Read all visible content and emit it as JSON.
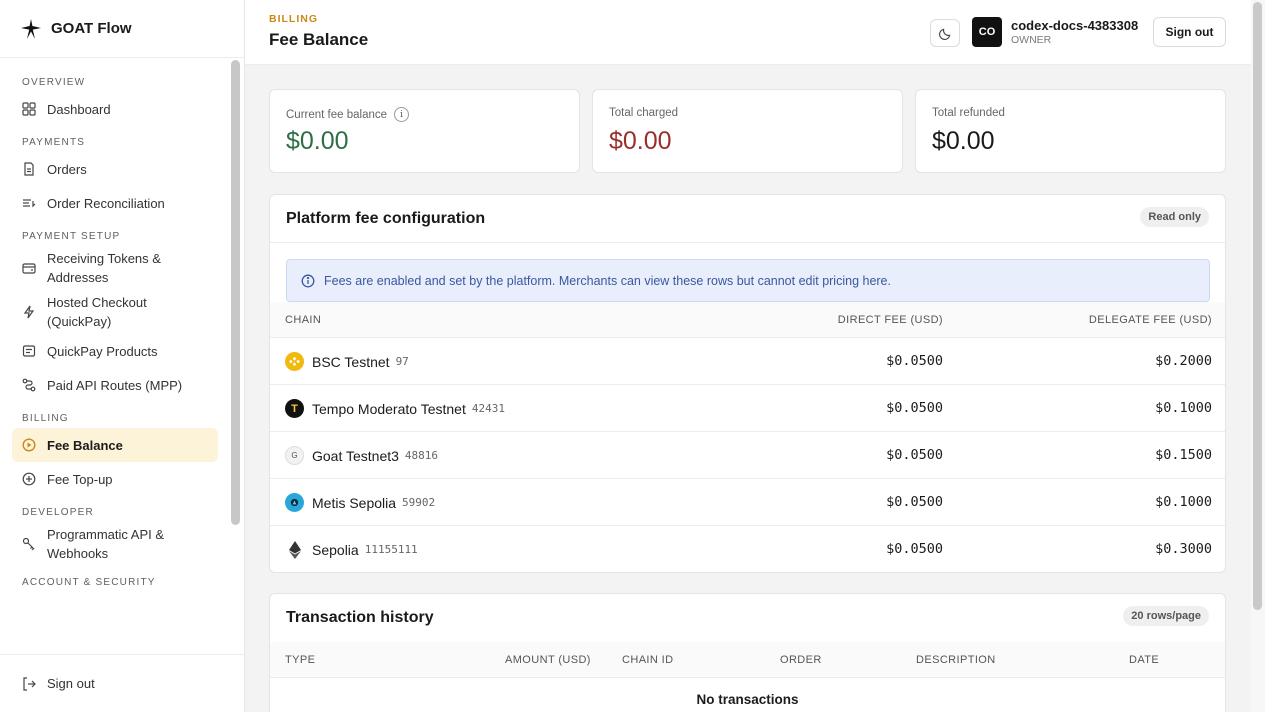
{
  "brand": {
    "name": "GOAT Flow"
  },
  "sidebar": {
    "sections": [
      {
        "label": "OVERVIEW",
        "items": [
          {
            "label": "Dashboard",
            "icon": "grid-icon"
          }
        ]
      },
      {
        "label": "PAYMENTS",
        "items": [
          {
            "label": "Orders",
            "icon": "document-icon"
          },
          {
            "label": "Order Reconciliation",
            "icon": "list-sync-icon"
          }
        ]
      },
      {
        "label": "PAYMENT SETUP",
        "items": [
          {
            "label": "Receiving Tokens & Addresses",
            "icon": "wallet-icon"
          },
          {
            "label": "Hosted Checkout (QuickPay)",
            "icon": "lightning-icon"
          },
          {
            "label": "QuickPay Products",
            "icon": "receipt-icon"
          },
          {
            "label": "Paid API Routes (MPP)",
            "icon": "route-icon"
          }
        ]
      },
      {
        "label": "BILLING",
        "items": [
          {
            "label": "Fee Balance",
            "icon": "coin-icon",
            "active": true
          },
          {
            "label": "Fee Top-up",
            "icon": "plus-circle-icon"
          }
        ]
      },
      {
        "label": "DEVELOPER",
        "items": [
          {
            "label": "Programmatic API & Webhooks",
            "icon": "key-icon"
          }
        ]
      },
      {
        "label": "ACCOUNT & SECURITY",
        "items": []
      }
    ],
    "signout_label": "Sign out"
  },
  "header": {
    "breadcrumb": "BILLING",
    "title": "Fee Balance",
    "avatar_initials": "CO",
    "user_name": "codex-docs-4383308",
    "user_role": "OWNER",
    "signout_label": "Sign out"
  },
  "stats": [
    {
      "label": "Current fee balance",
      "value": "$0.00",
      "color": "#2f6e45"
    },
    {
      "label": "Total charged",
      "value": "$0.00",
      "color": "#9a2e2a"
    },
    {
      "label": "Total refunded",
      "value": "$0.00",
      "color": "#1a1a1a"
    }
  ],
  "fee_config": {
    "title": "Platform fee configuration",
    "badge": "Read only",
    "notice": "Fees are enabled and set by the platform. Merchants can view these rows but cannot edit pricing here.",
    "columns": {
      "chain": "CHAIN",
      "direct": "DIRECT FEE (USD)",
      "delegate": "DELEGATE FEE (USD)"
    },
    "rows": [
      {
        "name": "BSC Testnet",
        "id": "97",
        "direct": "$0.0500",
        "delegate": "$0.2000",
        "icon": "bsc-icon"
      },
      {
        "name": "Tempo Moderato Testnet",
        "id": "42431",
        "direct": "$0.0500",
        "delegate": "$0.1000",
        "icon": "tempo-icon"
      },
      {
        "name": "Goat Testnet3",
        "id": "48816",
        "direct": "$0.0500",
        "delegate": "$0.1500",
        "icon": "goat-icon"
      },
      {
        "name": "Metis Sepolia",
        "id": "59902",
        "direct": "$0.0500",
        "delegate": "$0.1000",
        "icon": "metis-icon"
      },
      {
        "name": "Sepolia",
        "id": "11155111",
        "direct": "$0.0500",
        "delegate": "$0.3000",
        "icon": "ethereum-icon"
      }
    ]
  },
  "transactions": {
    "title": "Transaction history",
    "badge": "20 rows/page",
    "columns": {
      "type": "TYPE",
      "amount": "AMOUNT (USD)",
      "chain_id": "CHAIN ID",
      "order": "ORDER",
      "description": "DESCRIPTION",
      "date": "DATE"
    },
    "empty": "No transactions"
  }
}
